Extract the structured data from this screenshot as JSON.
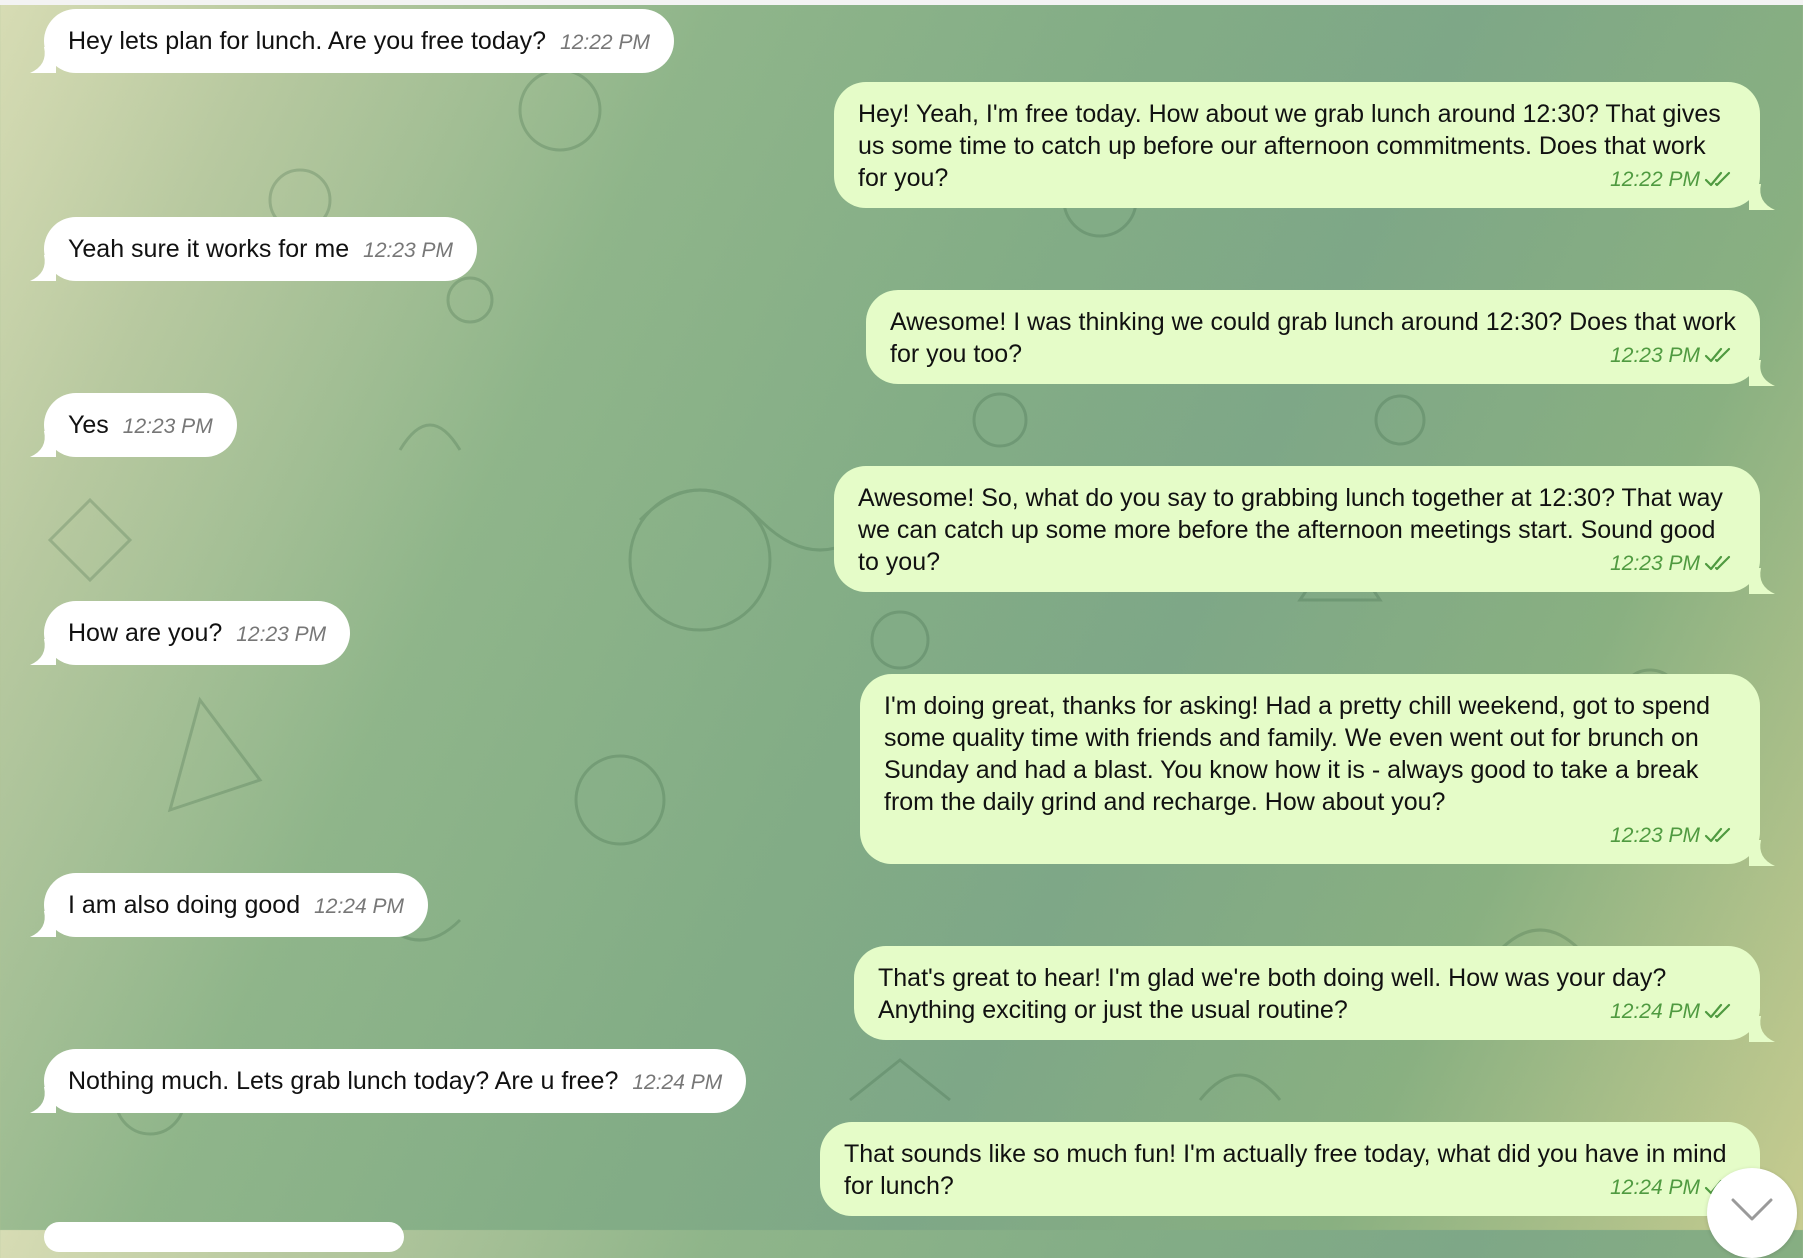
{
  "chat": {
    "incoming": [
      {
        "text": "Hey lets plan for lunch. Are you free today?",
        "time": "12:22 PM"
      },
      {
        "text": "Yeah sure it works for me",
        "time": "12:23 PM"
      },
      {
        "text": "Yes",
        "time": "12:23 PM"
      },
      {
        "text": "How are you?",
        "time": "12:23 PM"
      },
      {
        "text": "I am also doing good",
        "time": "12:24 PM"
      },
      {
        "text": "Nothing much. Lets grab lunch today? Are u free?",
        "time": "12:24 PM"
      }
    ],
    "outgoing": [
      {
        "text": "Hey! Yeah, I'm free today. How about we grab lunch around 12:30? That gives us some time to catch up before our afternoon commitments. Does that work for you?",
        "time": "12:22 PM"
      },
      {
        "text": "Awesome! I was thinking we could grab lunch around 12:30? Does that work for you too?",
        "time": "12:23 PM"
      },
      {
        "text": "Awesome! So, what do you say to grabbing lunch together at 12:30? That way we can catch up some more before the afternoon meetings start. Sound good to you?",
        "time": "12:23 PM"
      },
      {
        "text": "I'm doing great, thanks for asking! Had a pretty chill weekend, got to spend some quality time with friends and family. We even went out for brunch on Sunday and had a blast. You know how it is - always good to take a break from the daily grind and recharge. How about you?",
        "time": "12:23 PM"
      },
      {
        "text": "That's great to hear! I'm glad we're both doing well. How was your day? Anything exciting or just the usual routine?",
        "time": "12:24 PM"
      },
      {
        "text": "That sounds like so much fun! I'm actually free today, what did you have in mind for lunch?",
        "time": "12:24 PM"
      }
    ]
  },
  "icons": {
    "read_status": "double-check-icon",
    "scroll": "chevron-down-icon"
  },
  "colors": {
    "incoming_bubble": "#ffffff",
    "outgoing_bubble": "#e5fcc8",
    "outgoing_time": "#4f9a40",
    "incoming_time": "#777777"
  }
}
